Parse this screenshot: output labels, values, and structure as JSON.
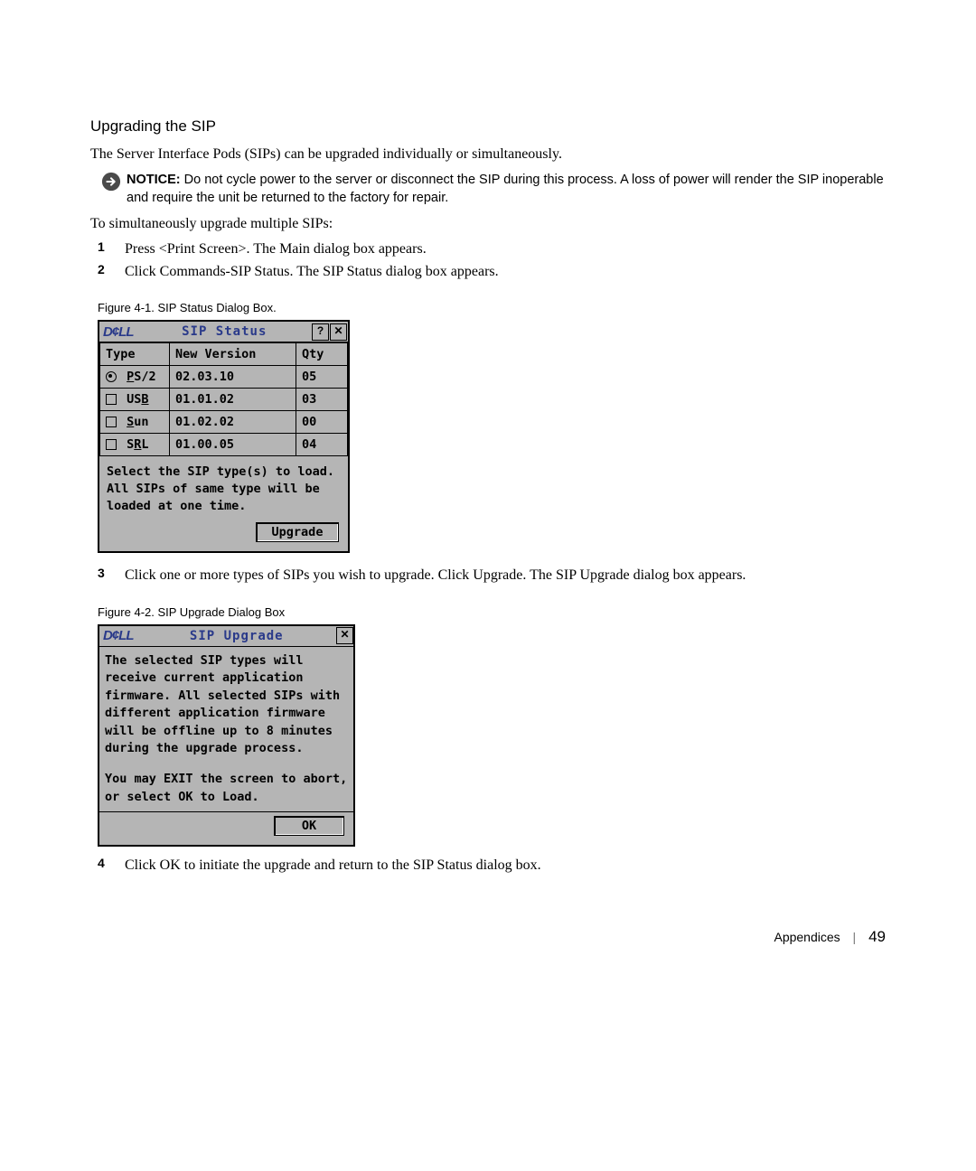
{
  "section_title": "Upgrading the SIP",
  "intro": "The Server Interface Pods (SIPs) can be upgraded individually or simultaneously.",
  "notice": {
    "label": "NOTICE:",
    "text": "Do not cycle power to the server or disconnect the SIP during this process. A loss of power will render the SIP inoperable and require the unit be returned to the factory for repair."
  },
  "lead_in": "To simultaneously upgrade multiple SIPs:",
  "steps_a": [
    "Press <Print Screen>. The Main dialog box appears.",
    "Click Commands-SIP Status. The SIP Status dialog box appears."
  ],
  "figure1": {
    "caption": "Figure 4-1.    SIP Status Dialog Box.",
    "logo": "D¢LL",
    "title": "SIP Status",
    "help_btn": "?",
    "close_btn": "✕",
    "headers": {
      "type": "Type",
      "version": "New Version",
      "qty": "Qty"
    },
    "rows": [
      {
        "shape": "radio",
        "sel": true,
        "label_prefix": "",
        "label_ul": "P",
        "label_rest": "S/2",
        "version": "02.03.10",
        "qty": "05"
      },
      {
        "shape": "checkbox",
        "sel": false,
        "label_prefix": "US",
        "label_ul": "B",
        "label_rest": "",
        "version": "01.01.02",
        "qty": "03"
      },
      {
        "shape": "checkbox",
        "sel": false,
        "label_prefix": "",
        "label_ul": "S",
        "label_rest": "un",
        "version": "01.02.02",
        "qty": "00"
      },
      {
        "shape": "checkbox",
        "sel": false,
        "label_prefix": "S",
        "label_ul": "R",
        "label_rest": "L",
        "version": "01.00.05",
        "qty": "04"
      }
    ],
    "message": "Select the SIP type(s) to load. All SIPs of same type will be loaded at one time.",
    "upgrade_btn": "Upgrade"
  },
  "step3": "Click one or more types of SIPs you wish to upgrade. Click Upgrade. The SIP Upgrade dialog box appears.",
  "figure2": {
    "caption": "Figure 4-2.    SIP Upgrade Dialog Box",
    "logo": "D¢LL",
    "title": "SIP Upgrade",
    "close_btn": "✕",
    "body1": "The selected SIP types will receive current application firmware. All selected SIPs with different application firmware will be offline up to 8 minutes during the upgrade process.",
    "body2": "You may EXIT the screen to abort, or select OK to Load.",
    "ok_btn": "OK"
  },
  "step4": "Click OK to initiate the upgrade and return to the SIP Status dialog box.",
  "footer": {
    "section": "Appendices",
    "page": "49"
  }
}
